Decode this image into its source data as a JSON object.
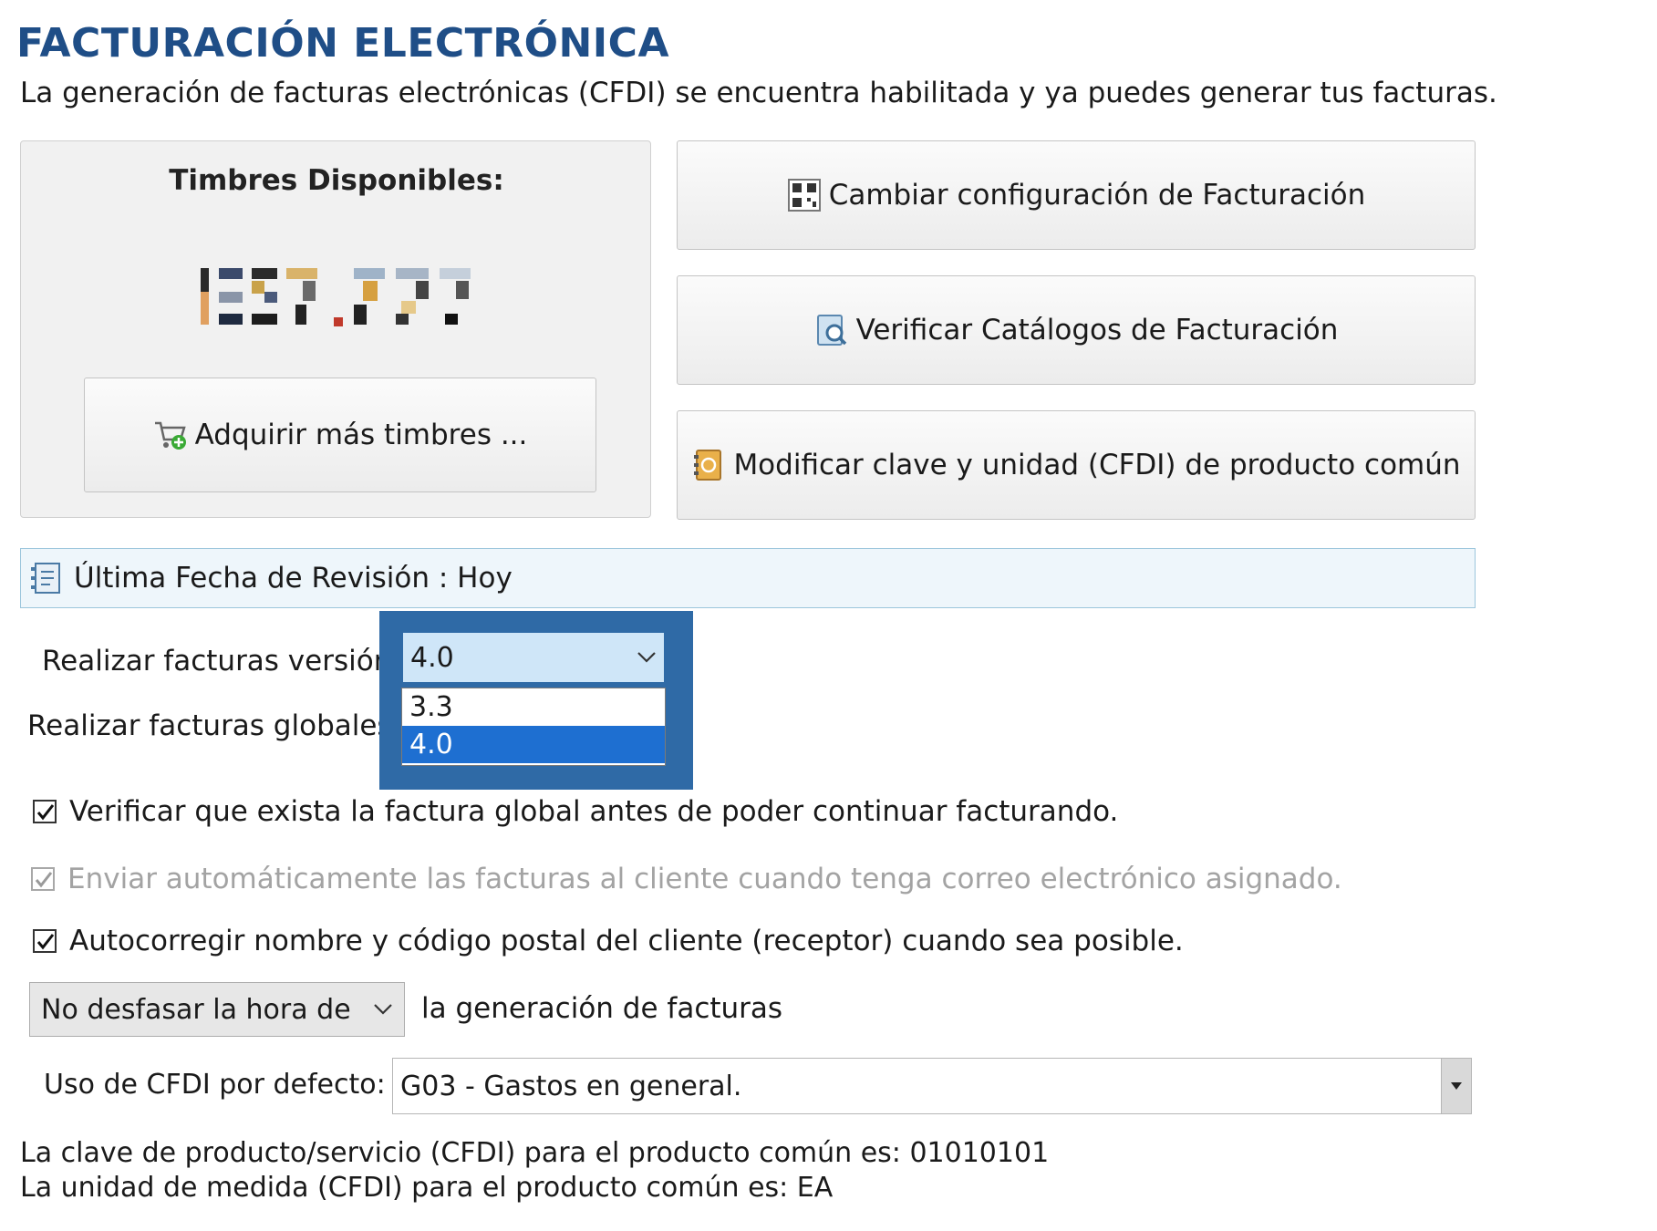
{
  "header": {
    "title": "FACTURACIÓN ELECTRÓNICA",
    "subtitle": "La generación de facturas electrónicas (CFDI) se encuentra habilitada y ya puedes generar tus facturas."
  },
  "stamps": {
    "label": "Timbres Disponibles:",
    "buy_button": "Adquirir más timbres ..."
  },
  "actions": {
    "config_button": "Cambiar configuración de Facturación",
    "catalog_button": "Verificar Catálogos de Facturación",
    "modify_button": "Modificar clave y unidad (CFDI) de producto común"
  },
  "revision": {
    "text": "Última Fecha de Revisión : Hoy"
  },
  "version": {
    "label": "Realizar facturas versión",
    "selected": "4.0",
    "options": [
      "3.3",
      "4.0"
    ],
    "highlighted_option": "4.0"
  },
  "global": {
    "label": "Realizar facturas globales"
  },
  "checkboxes": [
    {
      "label": "Verificar que exista la factura global antes de poder continuar facturando.",
      "checked": true,
      "disabled": false
    },
    {
      "label": "Enviar automáticamente las facturas al cliente cuando tenga correo electrónico asignado.",
      "checked": true,
      "disabled": true
    },
    {
      "label": "Autocorregir nombre y código postal del cliente (receptor) cuando sea posible.",
      "checked": true,
      "disabled": false
    }
  ],
  "offset": {
    "selected": "No desfasar la hora de",
    "suffix": "la generación de facturas"
  },
  "cfdi_use": {
    "label": "Uso de CFDI por defecto:",
    "selected": "G03 - Gastos en general."
  },
  "info": {
    "product_key": "La clave de producto/servicio (CFDI) para el producto común es: 01010101",
    "unit": "La unidad de medida (CFDI) para el producto común es: EA"
  },
  "colors": {
    "title": "#1f4e87",
    "dropdown_frame": "#2f6aa6",
    "selected_option": "#1e6fd1",
    "revision_bar": "#eef6fb"
  }
}
